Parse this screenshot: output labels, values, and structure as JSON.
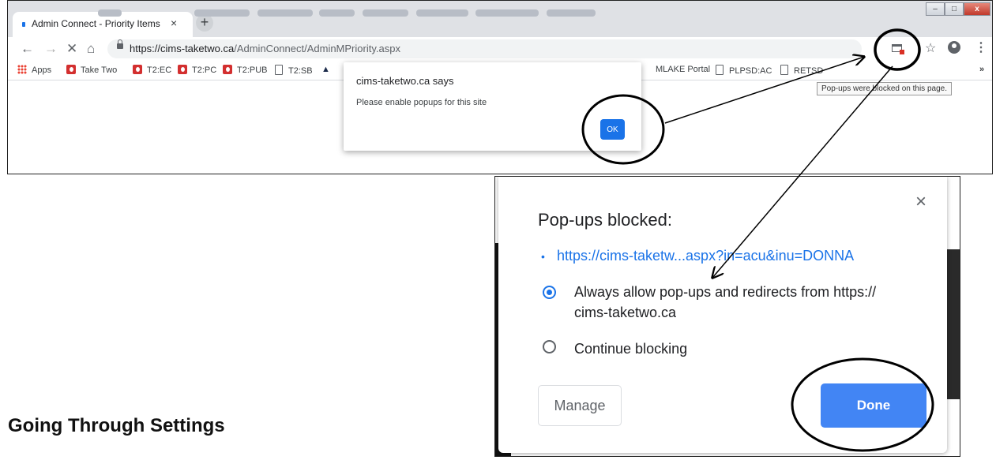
{
  "browser": {
    "tab_title": "Admin Connect - Priority Items",
    "tab_close": "×",
    "new_tab": "+",
    "window_controls": [
      "–",
      "□",
      "x"
    ],
    "url_host": "https://cims-taketwo.ca",
    "url_path": "/AdminConnect/AdminMPriority.aspx",
    "nav_icons": [
      "back-arrow-icon",
      "forward-arrow-icon",
      "stop-icon",
      "home-icon"
    ],
    "bookmarks": {
      "apps": "Apps",
      "take_two": "Take Two",
      "t2ec": "T2:EC",
      "t2pc": "T2:PC",
      "t2pub": "T2:PUB",
      "t2sb": "T2:SB",
      "mlake": "MLAKE Portal",
      "plpsd": "PLPSD:AC",
      "retsd": "RETSD",
      "more": "»"
    },
    "tooltip": "Pop-ups were blocked on this page.",
    "alert": {
      "title": "cims-taketwo.ca says",
      "message": "Please enable popups for this site",
      "ok_label": "OK"
    }
  },
  "popup_dialog": {
    "title": "Pop-ups blocked:",
    "close": "×",
    "blocked_link": "https://cims-taketw...aspx?in=acu&inu=DONNA",
    "option_allow_line1": "Always allow pop-ups and redirects from https://",
    "option_allow_line2": "cims-taketwo.ca",
    "option_block": "Continue blocking",
    "selected_option": "allow",
    "manage_label": "Manage",
    "done_label": "Done"
  },
  "heading": "Going Through Settings",
  "colors": {
    "accent": "#1a73e8",
    "done_button": "#4285f4",
    "annotation": "#000000"
  }
}
